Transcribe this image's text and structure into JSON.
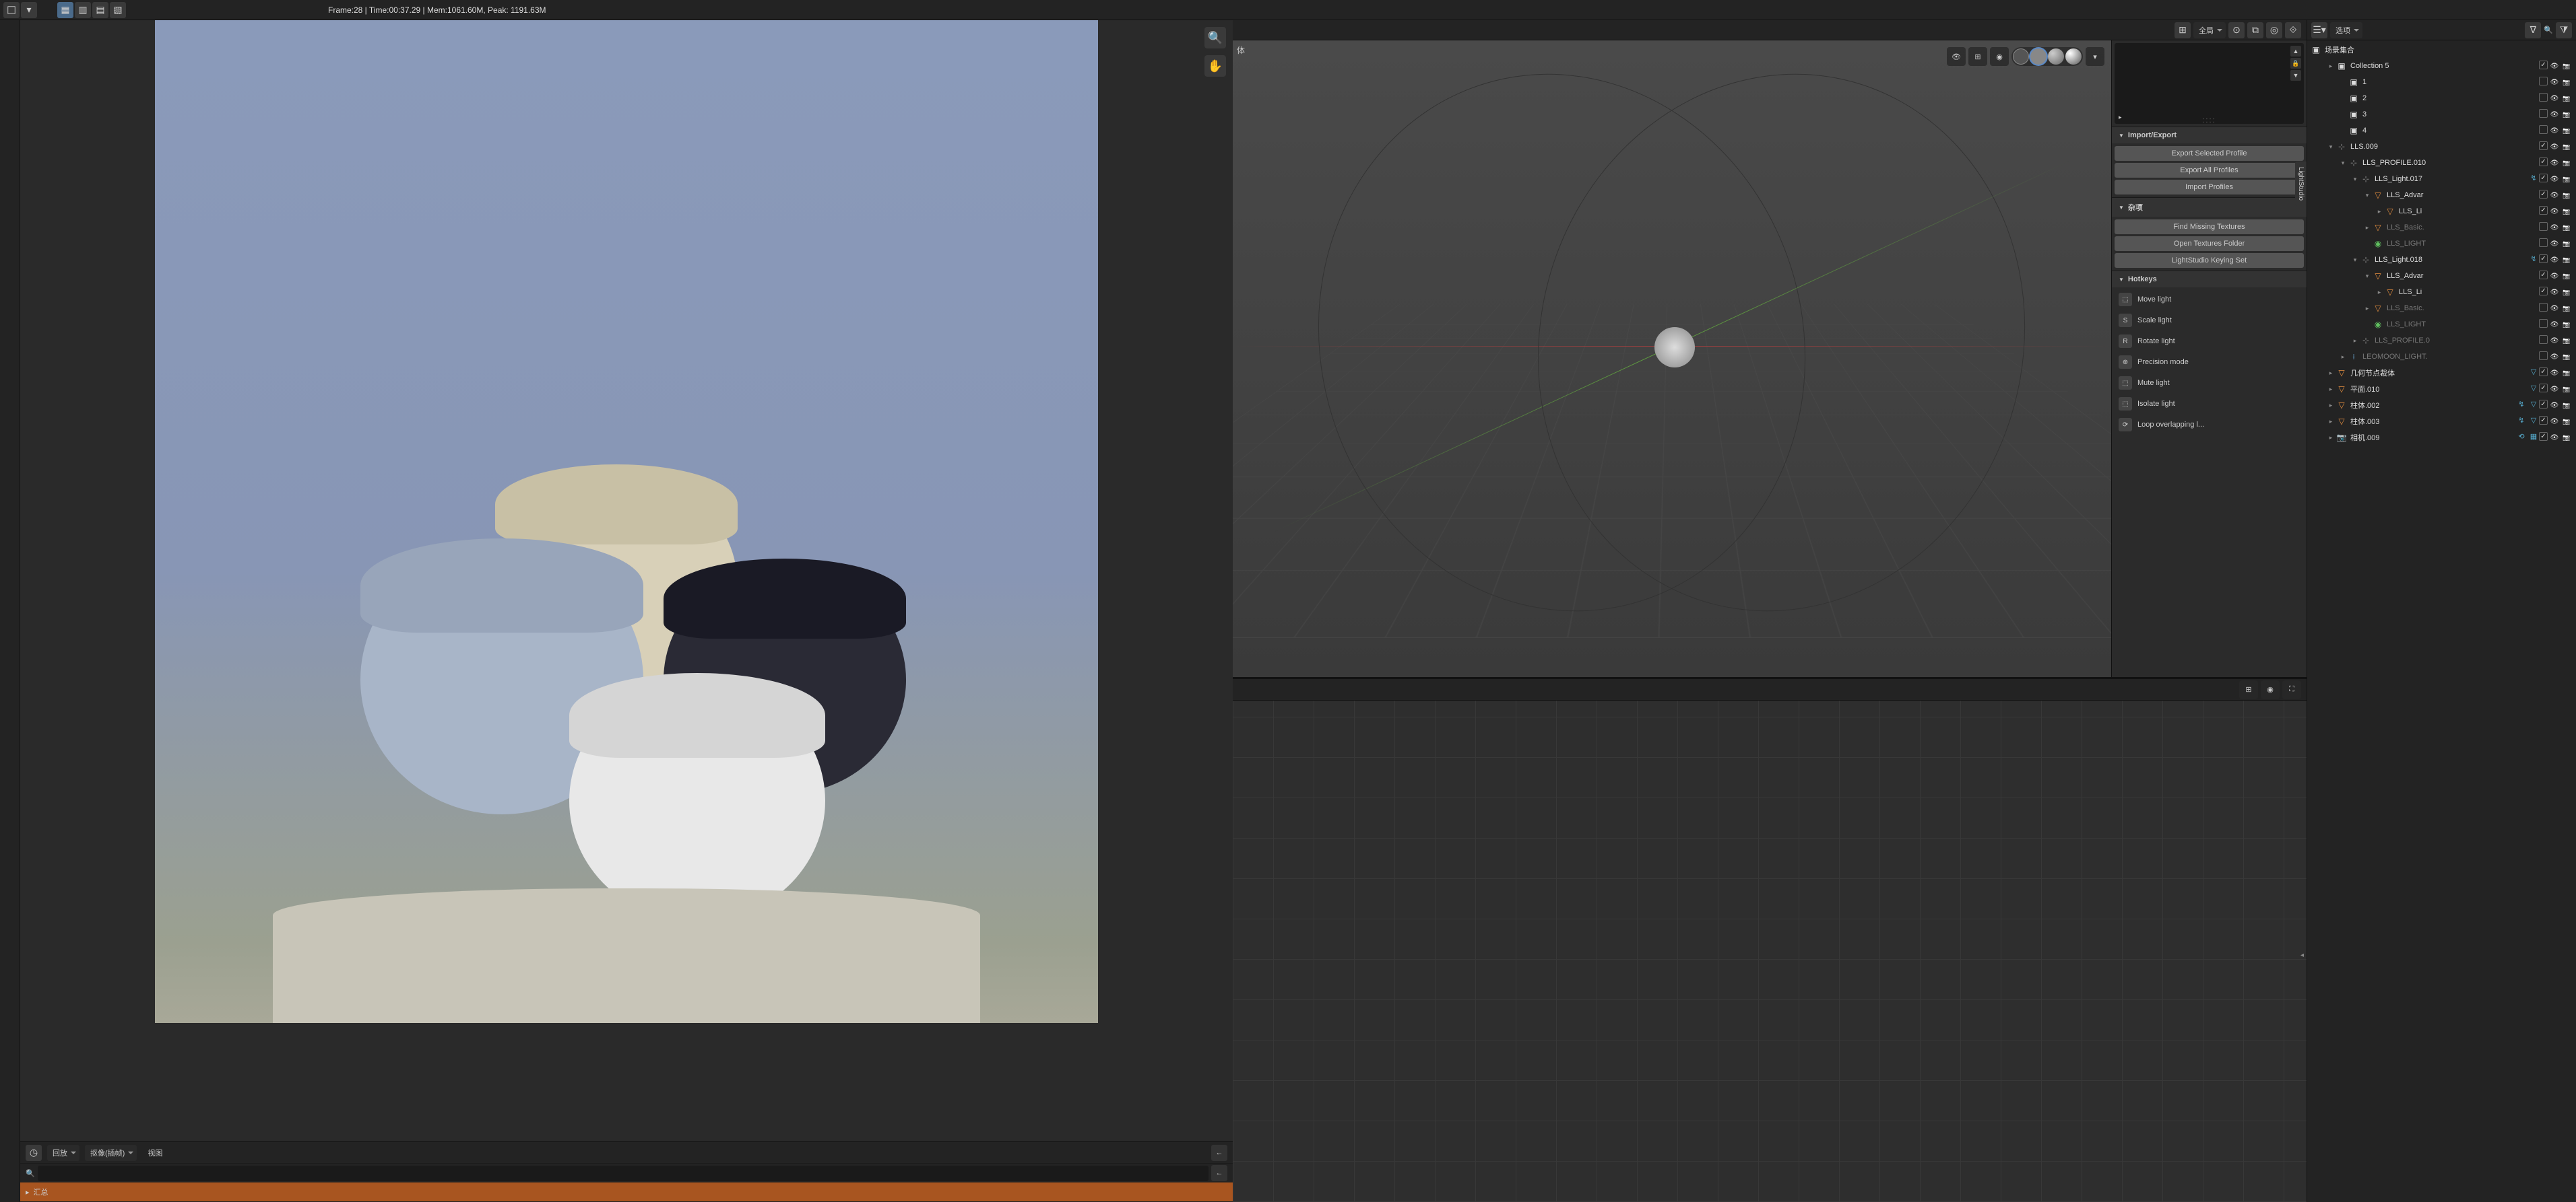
{
  "header": {
    "frame_info": "Frame:28 | Time:00:37.29 | Mem:1061.60M, Peak: 1191.63M",
    "global_dropdown": "全局",
    "options_dropdown": "选项",
    "object_label": "体"
  },
  "side_panel": {
    "tab_label": "LightStudio",
    "import_export": {
      "title": "Import/Export",
      "export_selected": "Export Selected Profile",
      "export_all": "Export All Profiles",
      "import_profiles": "Import Profiles"
    },
    "misc": {
      "title": "杂项",
      "find_missing": "Find Missing Textures",
      "open_folder": "Open Textures Folder",
      "keying_set": "LightStudio Keying Set"
    },
    "hotkeys": {
      "title": "Hotkeys",
      "items": [
        {
          "key": "⬚",
          "label": "Move light"
        },
        {
          "key": "S",
          "label": "Scale light"
        },
        {
          "key": "R",
          "label": "Rotate light"
        },
        {
          "key": "⊕",
          "label": "Precision mode"
        },
        {
          "key": "⬚",
          "label": "Mute light"
        },
        {
          "key": "⬚",
          "label": "Isolate light"
        },
        {
          "key": "⟳",
          "label": "Loop overlapping l..."
        }
      ]
    }
  },
  "outliner": {
    "scene_collection": "场景集合",
    "items": [
      {
        "depth": 1,
        "icon": "collection",
        "label": "Collection 5",
        "checked": true,
        "toggle": "▸"
      },
      {
        "depth": 2,
        "icon": "collection",
        "label": "1",
        "checked": false,
        "toggle": ""
      },
      {
        "depth": 2,
        "icon": "collection",
        "label": "2",
        "checked": false,
        "toggle": ""
      },
      {
        "depth": 2,
        "icon": "collection",
        "label": "3",
        "checked": false,
        "toggle": ""
      },
      {
        "depth": 2,
        "icon": "collection",
        "label": "4",
        "checked": false,
        "toggle": ""
      },
      {
        "depth": 1,
        "icon": "empty",
        "label": "LLS.009",
        "checked": true,
        "toggle": "▾"
      },
      {
        "depth": 2,
        "icon": "empty",
        "label": "LLS_PROFILE.010",
        "checked": true,
        "toggle": "▾"
      },
      {
        "depth": 3,
        "icon": "empty",
        "label": "LLS_Light.017",
        "checked": true,
        "toggle": "▾",
        "extras": [
          "↯"
        ]
      },
      {
        "depth": 4,
        "icon": "mesh",
        "label": "LLS_Advar",
        "checked": true,
        "toggle": "▾"
      },
      {
        "depth": 5,
        "icon": "mesh",
        "label": "LLS_Li",
        "checked": true,
        "toggle": "▸"
      },
      {
        "depth": 4,
        "icon": "mesh",
        "label": "LLS_Basic.",
        "checked": false,
        "muted": true,
        "toggle": "▸"
      },
      {
        "depth": 4,
        "icon": "light",
        "label": "LLS_LIGHT",
        "checked": false,
        "muted": true,
        "toggle": ""
      },
      {
        "depth": 3,
        "icon": "empty",
        "label": "LLS_Light.018",
        "checked": true,
        "toggle": "▾",
        "extras": [
          "↯"
        ]
      },
      {
        "depth": 4,
        "icon": "mesh",
        "label": "LLS_Advar",
        "checked": true,
        "toggle": "▾"
      },
      {
        "depth": 5,
        "icon": "mesh",
        "label": "LLS_Li",
        "checked": true,
        "toggle": "▸"
      },
      {
        "depth": 4,
        "icon": "mesh",
        "label": "LLS_Basic.",
        "checked": false,
        "muted": true,
        "toggle": "▸"
      },
      {
        "depth": 4,
        "icon": "light",
        "label": "LLS_LIGHT",
        "checked": false,
        "muted": true,
        "toggle": ""
      },
      {
        "depth": 3,
        "icon": "empty",
        "label": "LLS_PROFILE.0",
        "muted": true,
        "toggle": "▸"
      },
      {
        "depth": 2,
        "icon": "armature",
        "label": "LEOMOON_LIGHT.",
        "muted": true,
        "toggle": "▸"
      },
      {
        "depth": 1,
        "icon": "mesh",
        "label": "几何节点裁体",
        "checked": true,
        "toggle": "▸",
        "extras": [
          "▽"
        ]
      },
      {
        "depth": 1,
        "icon": "mesh",
        "label": "平面.010",
        "checked": true,
        "toggle": "▸",
        "extras": [
          "▽"
        ]
      },
      {
        "depth": 1,
        "icon": "mesh",
        "label": "柱体.002",
        "checked": true,
        "toggle": "▸",
        "extras": [
          "↯",
          "▽"
        ]
      },
      {
        "depth": 1,
        "icon": "mesh",
        "label": "柱体.003",
        "checked": true,
        "toggle": "▸",
        "extras": [
          "↯",
          "▽"
        ]
      },
      {
        "depth": 1,
        "icon": "camera",
        "label": "相机.009",
        "checked": true,
        "toggle": "▸",
        "extras": [
          "⟲",
          "▦"
        ]
      }
    ]
  },
  "bottom": {
    "playback": "回放",
    "keying": "抠像(插帧)",
    "view": "视图",
    "summary": "汇总",
    "search_icon": "🔍"
  },
  "icons": {
    "magnify": "🔍",
    "hand": "✋",
    "funnel": "⧩"
  }
}
